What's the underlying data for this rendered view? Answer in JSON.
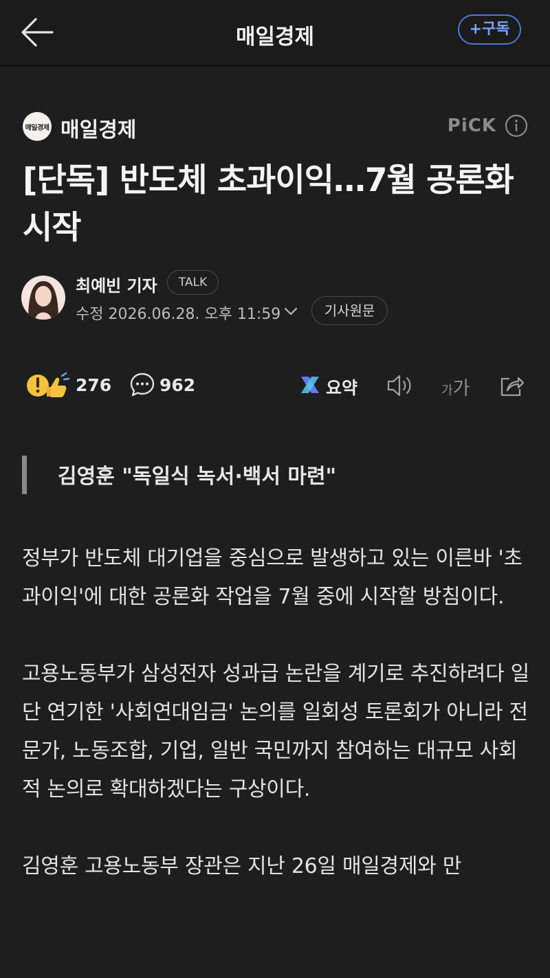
{
  "header": {
    "title": "매일경제",
    "subscribe_label": "+구독"
  },
  "publisher": {
    "logo_text": "매일경제",
    "name": "매일경제",
    "pick_label": "PiCK"
  },
  "article": {
    "headline": "[단독] 반도체 초과이익…7월 공론화 시작",
    "reporter": "최예빈 기자",
    "talk_label": "TALK",
    "timestamp": "수정 2026.06.28. 오후 11:59",
    "original_label": "기사원문",
    "subheading": "김영훈 \"독일식 녹서·백서 마련\"",
    "paragraphs": [
      "정부가 반도체 대기업을 중심으로 발생하고 있는 이른바 '초과이익'에 대한 공론화 작업을 7월 중에 시작할 방침이다.",
      "고용노동부가 삼성전자 성과급 논란을 계기로 추진하려다 일단 연기한 '사회연대임금' 논의를 일회성 토론회가 아니라 전문가, 노동조합, 기업, 일반 국민까지 참여하는 대규모 사회적 논의로 확대하겠다는 구상이다.",
      "김영훈 고용노동부 장관은 지난 26일 매일경제와 만"
    ]
  },
  "actions": {
    "reaction_count": "276",
    "comment_count": "962",
    "summary_label": "요약",
    "font_small": "가",
    "font_large": "가"
  },
  "colors": {
    "background": "#1e1e1f",
    "accent": "#4d78e0"
  }
}
